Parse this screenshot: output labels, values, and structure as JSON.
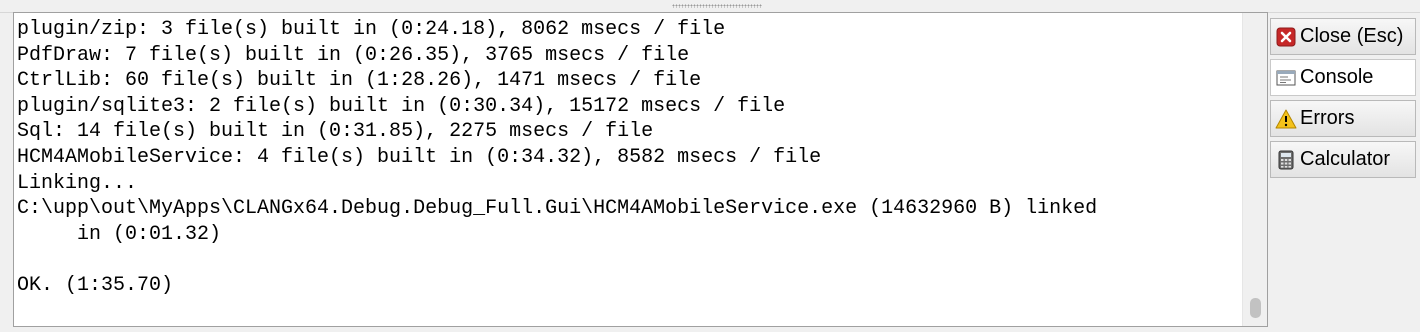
{
  "console": {
    "lines": [
      "plugin/zip: 3 file(s) built in (0:24.18), 8062 msecs / file",
      "PdfDraw: 7 file(s) built in (0:26.35), 3765 msecs / file",
      "CtrlLib: 60 file(s) built in (1:28.26), 1471 msecs / file",
      "plugin/sqlite3: 2 file(s) built in (0:30.34), 15172 msecs / file",
      "Sql: 14 file(s) built in (0:31.85), 2275 msecs / file",
      "HCM4AMobileService: 4 file(s) built in (0:34.32), 8582 msecs / file",
      "Linking...",
      "C:\\upp\\out\\MyApps\\CLANGx64.Debug.Debug_Full.Gui\\HCM4AMobileService.exe (14632960 B) linked",
      "     in (0:01.32)",
      "",
      "OK. (1:35.70)"
    ]
  },
  "side_tabs": {
    "close": {
      "label": "Close (Esc)",
      "icon": "close-x-icon",
      "color": "#c0392b"
    },
    "console": {
      "label": "Console",
      "icon": "console-icon"
    },
    "errors": {
      "label": "Errors",
      "icon": "warning-icon",
      "color": "#f1c40f"
    },
    "calculator": {
      "label": "Calculator",
      "icon": "calculator-icon"
    }
  }
}
